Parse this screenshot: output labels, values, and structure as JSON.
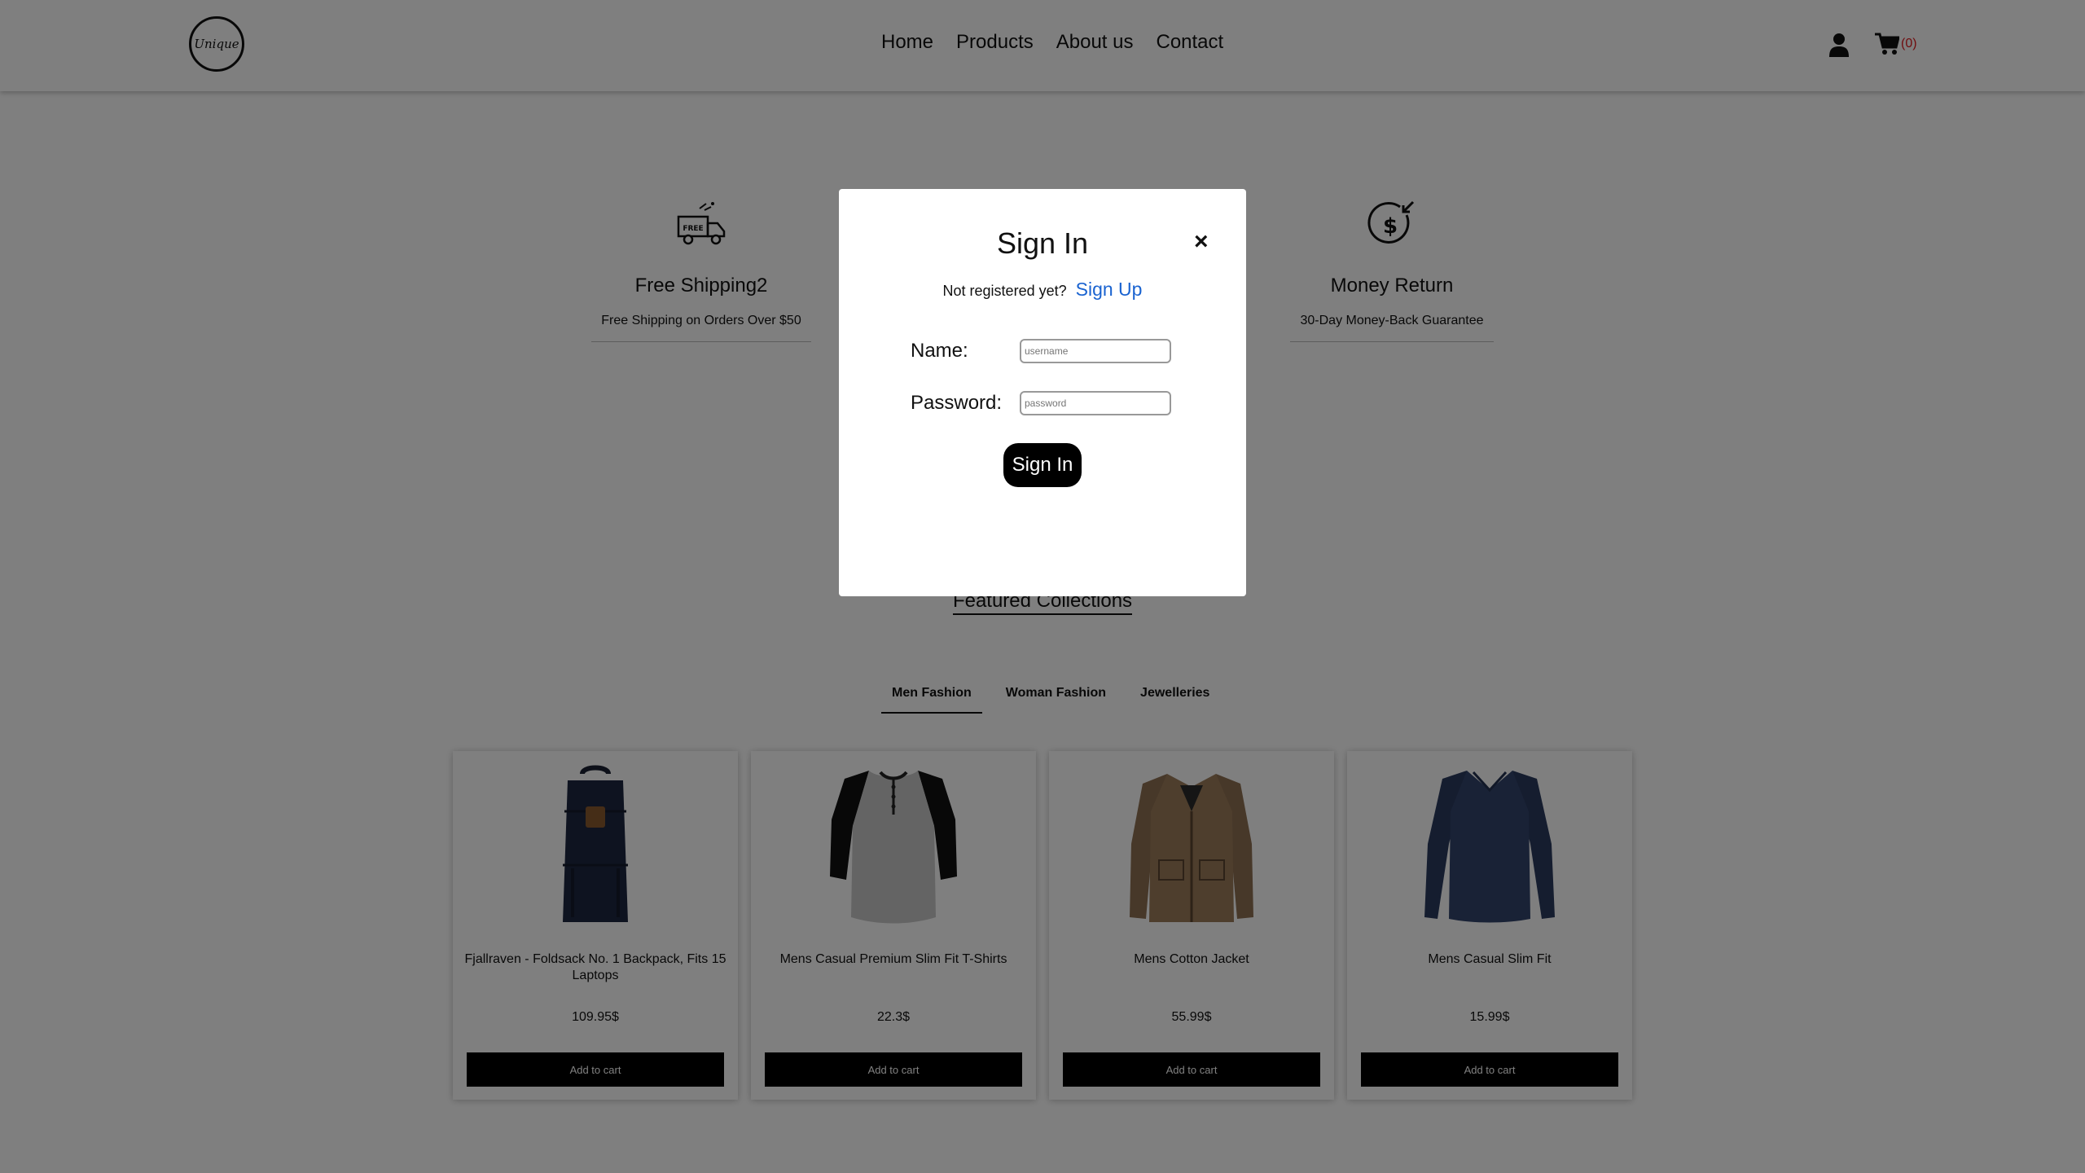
{
  "header": {
    "logo_text": "Unique",
    "nav": [
      "Home",
      "Products",
      "About us",
      "Contact"
    ],
    "cart_count": "(0)"
  },
  "features": [
    {
      "icon": "free-shipping-truck-icon",
      "title": "Free Shipping2",
      "subtitle": "Free Shipping on Orders Over $50"
    },
    {
      "icon": "money-return-icon",
      "title": "Money Return",
      "subtitle": "30-Day Money-Back Guarantee"
    }
  ],
  "featured": {
    "title": "Featured Collections",
    "tabs": [
      "Men Fashion",
      "Woman Fashion",
      "Jewelleries"
    ],
    "active_tab": "Men Fashion"
  },
  "products": [
    {
      "name": "Fjallraven - Foldsack No. 1 Backpack, Fits 15 Laptops",
      "price": "109.95$",
      "button": "Add to cart"
    },
    {
      "name": "Mens Casual Premium Slim Fit T-Shirts",
      "price": "22.3$",
      "button": "Add to cart"
    },
    {
      "name": "Mens Cotton Jacket",
      "price": "55.99$",
      "button": "Add to cart"
    },
    {
      "name": "Mens Casual Slim Fit",
      "price": "15.99$",
      "button": "Add to cart"
    }
  ],
  "modal": {
    "title": "Sign In",
    "close": "×",
    "not_registered": "Not registered yet?",
    "signup_link": "Sign Up",
    "name_label": "Name:",
    "name_placeholder": "username",
    "password_label": "Password:",
    "password_placeholder": "password",
    "submit": "Sign In"
  },
  "colors": {
    "accent_link": "#1a63d0",
    "cart_count": "#e0191d",
    "overlay": "rgba(0,0,0,0.5)"
  }
}
